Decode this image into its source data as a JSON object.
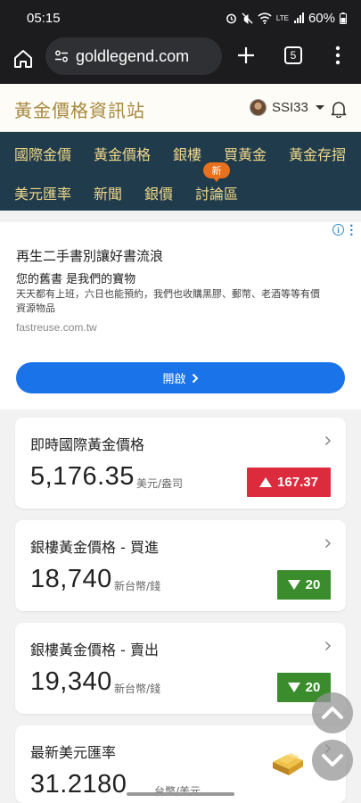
{
  "status_bar": {
    "time": "05:15",
    "battery": "60%",
    "network": "LTE"
  },
  "browser": {
    "url": "goldlegend.com",
    "tab_count": "5"
  },
  "site": {
    "logo": "黃金價格資訊站",
    "username": "SSI33"
  },
  "nav": {
    "row1": [
      "國際金價",
      "黃金價格",
      "銀樓",
      "買黃金",
      "黃金存摺"
    ],
    "row2": [
      "美元匯率",
      "新聞",
      "銀價",
      "討論區"
    ],
    "new_badge": "新"
  },
  "ad": {
    "title": "再生二手書別讓好書流浪",
    "subtitle": "您的舊書 是我們的寶物",
    "description": "天天都有上班，六日也能預約，我們也收購黑膠、郵幣、老酒等等有價資源物品",
    "url": "fastreuse.com.tw",
    "button_label": "開啟"
  },
  "cards": [
    {
      "title": "即時國際黃金價格",
      "value": "5,176.35",
      "unit": "美元/盎司",
      "change": "167.37",
      "direction": "up"
    },
    {
      "title": "銀樓黃金價格 - 買進",
      "value": "18,740",
      "unit": "新台幣/錢",
      "change": "20",
      "direction": "down"
    },
    {
      "title": "銀樓黃金價格 - 賣出",
      "value": "19,340",
      "unit": "新台幣/錢",
      "change": "20",
      "direction": "down"
    },
    {
      "title": "最新美元匯率",
      "value": "31.2180",
      "unit": "台幣/美元"
    }
  ],
  "colors": {
    "nav_bg": "#1f3b4c",
    "nav_text": "#f1d88a",
    "logo": "#a8873b",
    "up": "#dc2b3d",
    "down": "#3a8c2c",
    "ad_button": "#1a73e8",
    "badge": "#e8711d"
  },
  "icons": {
    "home": "home-icon",
    "plus": "plus-icon",
    "tabs": "tabs-icon",
    "menu": "more-vert-icon",
    "bell": "bell-icon",
    "scroll_up": "chevron-up-icon",
    "scroll_down": "chevron-down-icon",
    "gold": "gold-bar-icon"
  }
}
